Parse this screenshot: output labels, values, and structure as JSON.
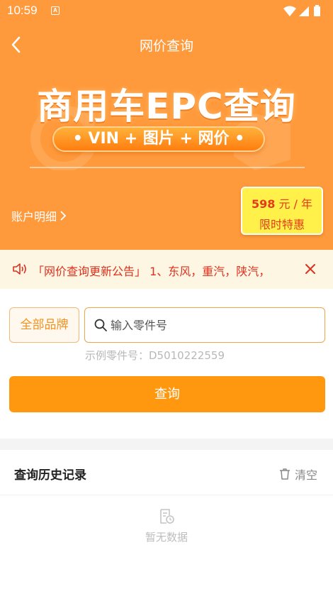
{
  "status_bar": {
    "time": "10:59",
    "a_glyph": "A"
  },
  "nav": {
    "title": "网价查询"
  },
  "banner": {
    "title": "商用车EPC查询",
    "pill": "• VIN + 图片 + 网价 •"
  },
  "account": {
    "label": "账户明细"
  },
  "price_badge": {
    "amount": "598",
    "unit": " 元 / 年",
    "promo": "限时特惠"
  },
  "notice": {
    "text": "「网价查询更新公告」 1、东风，重汽，陕汽，"
  },
  "search": {
    "brand_label": "全部品牌",
    "placeholder": "输入零件号",
    "value": "",
    "example": "示例零件号：D5010222559",
    "query_label": "查询"
  },
  "history": {
    "title": "查询历史记录",
    "clear_label": "清空",
    "empty_text": "暂无数据"
  },
  "colors": {
    "accent": "#ff980f",
    "hero": "#ff9a3c",
    "notice_text": "#e0301e"
  },
  "icons": [
    "back-arrow-icon",
    "wifi-icon",
    "signal-icon",
    "battery-icon",
    "speaker-icon",
    "close-icon",
    "chevron-right-icon",
    "search-icon",
    "trash-icon",
    "empty-record-icon"
  ]
}
